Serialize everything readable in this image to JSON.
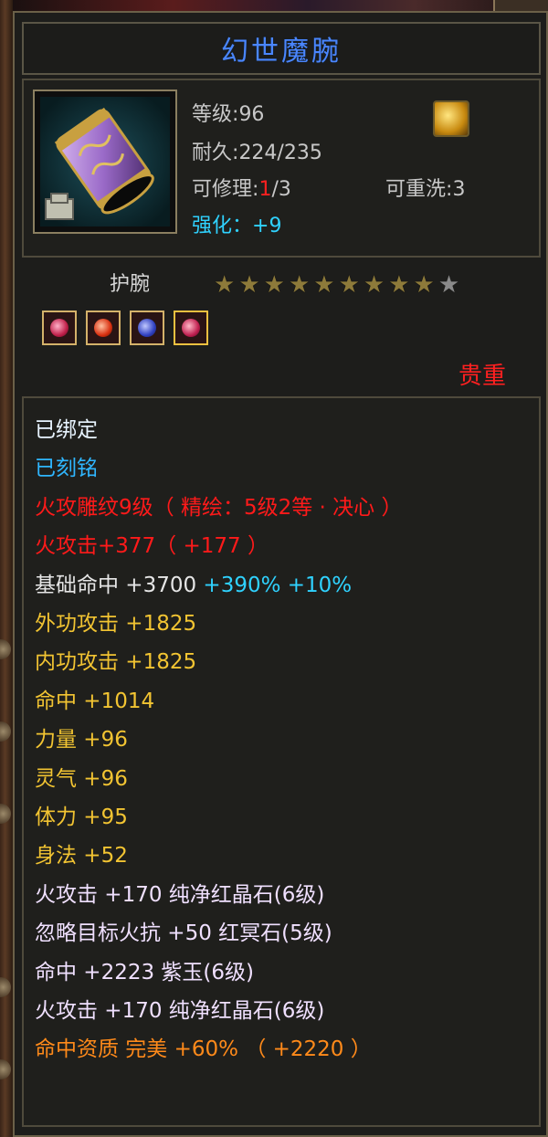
{
  "title": "幻世魔腕",
  "info": {
    "level_label": "等级",
    "level_value": "96",
    "durability_label": "耐久",
    "durability_value": "224/235",
    "repair_label": "可修理",
    "repair_used": "1",
    "repair_total": "/3",
    "reroll_label": "可重洗",
    "reroll_value": "3",
    "enhance_label": "强化",
    "enhance_value": "+9",
    "colon": ":",
    "fullwidth_colon": "："
  },
  "item_type": "护腕",
  "stars": {
    "filled": 9,
    "total": 10
  },
  "gems": [
    "pink-gem",
    "red-gem",
    "blue-gem",
    "pink-gem-selected"
  ],
  "rarity": "贵重",
  "attributes": [
    {
      "text": "已绑定",
      "color": "bind"
    },
    {
      "text": "已刻铭",
      "color": "carve"
    },
    {
      "text": "火攻雕纹9级（ 精绘：5级2等 · 决心 ）",
      "color": "red"
    },
    {
      "text": "火攻击+377（ +177 ）",
      "color": "red"
    },
    {
      "text": "基础命中 +3700",
      "color": "white",
      "extra": " +390% +10%"
    },
    {
      "text": "外功攻击 +1825",
      "color": "gold"
    },
    {
      "text": "内功攻击 +1825",
      "color": "gold"
    },
    {
      "text": "命中 +1014",
      "color": "gold"
    },
    {
      "text": "力量 +96",
      "color": "gold"
    },
    {
      "text": "灵气 +96",
      "color": "gold"
    },
    {
      "text": "体力 +95",
      "color": "gold"
    },
    {
      "text": "身法 +52",
      "color": "gold"
    },
    {
      "text": "火攻击 +170 纯净红晶石(6级)",
      "color": "lilac"
    },
    {
      "text": "忽略目标火抗 +50 红冥石(5级)",
      "color": "lilac"
    },
    {
      "text": "命中 +2223 紫玉(6级)",
      "color": "lilac"
    },
    {
      "text": "火攻击 +170 纯净红晶石(6级)",
      "color": "lilac"
    },
    {
      "text": "命中资质   完美 +60% （ +2220 ）",
      "color": "orange"
    }
  ],
  "colors": {
    "title": "#4a86ff",
    "red": "#ff1a1a",
    "cyan": "#2fd2ff",
    "gold": "#f2c432",
    "orange": "#ff8a1a",
    "rarity": "#ff2020"
  }
}
